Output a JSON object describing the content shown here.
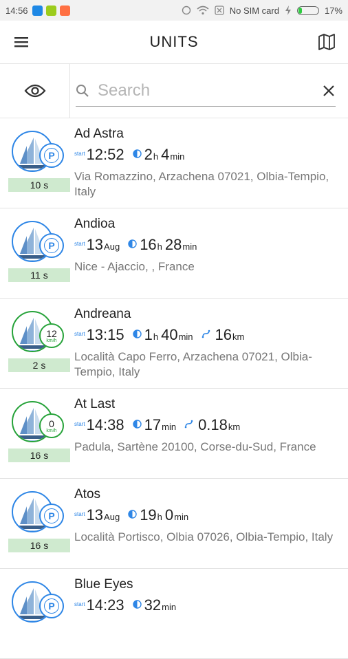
{
  "status_bar": {
    "time": "14:56",
    "sim": "No SIM card",
    "battery": "17%"
  },
  "app_bar": {
    "title": "UNITS"
  },
  "search": {
    "placeholder": "Search",
    "value": ""
  },
  "units": [
    {
      "name": "Ad Astra",
      "start_value": "12:52",
      "start_unit": "",
      "dur_a": "2",
      "dur_a_unit": "h",
      "dur_b": "4",
      "dur_b_unit": "min",
      "dist": "",
      "dist_unit": "",
      "address": "Via Romazzino, Arzachena 07021, Olbia-Tempio, Italy",
      "age": "10 s",
      "state": "parked",
      "color": "#2e86e6"
    },
    {
      "name": "Andioa",
      "start_value": "13",
      "start_unit": "Aug",
      "dur_a": "16",
      "dur_a_unit": "h",
      "dur_b": "28",
      "dur_b_unit": "min",
      "dist": "",
      "dist_unit": "",
      "address": "Nice - Ajaccio,  , France",
      "age": "11 s",
      "state": "parked",
      "color": "#2e86e6"
    },
    {
      "name": "Andreana",
      "start_value": "13:15",
      "start_unit": "",
      "dur_a": "1",
      "dur_a_unit": "h",
      "dur_b": "40",
      "dur_b_unit": "min",
      "dist": "16",
      "dist_unit": "km",
      "address": "Località Capo Ferro, Arzachena 07021, Olbia-Tempio, Italy",
      "age": "2 s",
      "state": "moving",
      "speed": "12",
      "speed_unit": "km/h",
      "color": "#27a33a"
    },
    {
      "name": "At Last",
      "start_value": "14:38",
      "start_unit": "",
      "dur_a": "17",
      "dur_a_unit": "min",
      "dur_b": "",
      "dur_b_unit": "",
      "dist": "0.18",
      "dist_unit": "km",
      "address": "Padula, Sartène 20100, Corse-du-Sud, France",
      "age": "16 s",
      "state": "moving",
      "speed": "0",
      "speed_unit": "km/h",
      "color": "#27a33a"
    },
    {
      "name": "Atos",
      "start_value": "13",
      "start_unit": "Aug",
      "dur_a": "19",
      "dur_a_unit": "h",
      "dur_b": "0",
      "dur_b_unit": "min",
      "dist": "",
      "dist_unit": "",
      "address": "Località Portisco, Olbia 07026, Olbia-Tempio, Italy",
      "age": "16 s",
      "state": "parked",
      "color": "#2e86e6"
    },
    {
      "name": "Blue Eyes",
      "start_value": "14:23",
      "start_unit": "",
      "dur_a": "32",
      "dur_a_unit": "min",
      "dur_b": "",
      "dur_b_unit": "",
      "dist": "",
      "dist_unit": "",
      "address": "",
      "age": "",
      "state": "parked",
      "color": "#2e86e6"
    }
  ],
  "labels": {
    "start": "start",
    "parked_badge": "P"
  },
  "icons": {
    "menu": "hamburger-menu-icon",
    "map": "map-icon",
    "visibility": "eye-icon",
    "search": "search-icon",
    "clear": "close-icon",
    "duration": "clock-icon",
    "distance": "route-icon"
  }
}
